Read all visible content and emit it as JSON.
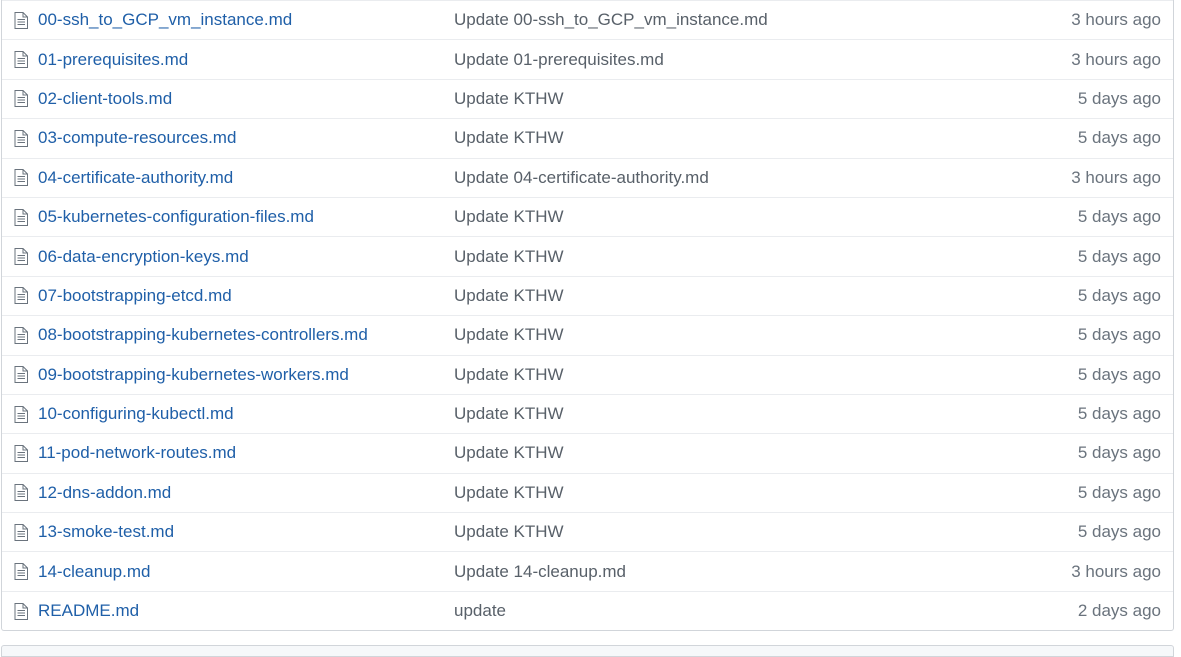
{
  "files": [
    {
      "name": "00-ssh_to_GCP_vm_instance.md",
      "message": "Update 00-ssh_to_GCP_vm_instance.md",
      "age": "3 hours ago"
    },
    {
      "name": "01-prerequisites.md",
      "message": "Update 01-prerequisites.md",
      "age": "3 hours ago"
    },
    {
      "name": "02-client-tools.md",
      "message": "Update KTHW",
      "age": "5 days ago"
    },
    {
      "name": "03-compute-resources.md",
      "message": "Update KTHW",
      "age": "5 days ago"
    },
    {
      "name": "04-certificate-authority.md",
      "message": "Update 04-certificate-authority.md",
      "age": "3 hours ago"
    },
    {
      "name": "05-kubernetes-configuration-files.md",
      "message": "Update KTHW",
      "age": "5 days ago"
    },
    {
      "name": "06-data-encryption-keys.md",
      "message": "Update KTHW",
      "age": "5 days ago"
    },
    {
      "name": "07-bootstrapping-etcd.md",
      "message": "Update KTHW",
      "age": "5 days ago"
    },
    {
      "name": "08-bootstrapping-kubernetes-controllers.md",
      "message": "Update KTHW",
      "age": "5 days ago"
    },
    {
      "name": "09-bootstrapping-kubernetes-workers.md",
      "message": "Update KTHW",
      "age": "5 days ago"
    },
    {
      "name": "10-configuring-kubectl.md",
      "message": "Update KTHW",
      "age": "5 days ago"
    },
    {
      "name": "11-pod-network-routes.md",
      "message": "Update KTHW",
      "age": "5 days ago"
    },
    {
      "name": "12-dns-addon.md",
      "message": "Update KTHW",
      "age": "5 days ago"
    },
    {
      "name": "13-smoke-test.md",
      "message": "Update KTHW",
      "age": "5 days ago"
    },
    {
      "name": "14-cleanup.md",
      "message": "Update 14-cleanup.md",
      "age": "3 hours ago"
    },
    {
      "name": "README.md",
      "message": "update",
      "age": "2 days ago"
    }
  ],
  "icons": {
    "file": "file-text-icon"
  },
  "colors": {
    "link": "#1f5fa8",
    "text": "#586069",
    "muted": "#6a737d",
    "border": "#eaecef"
  }
}
